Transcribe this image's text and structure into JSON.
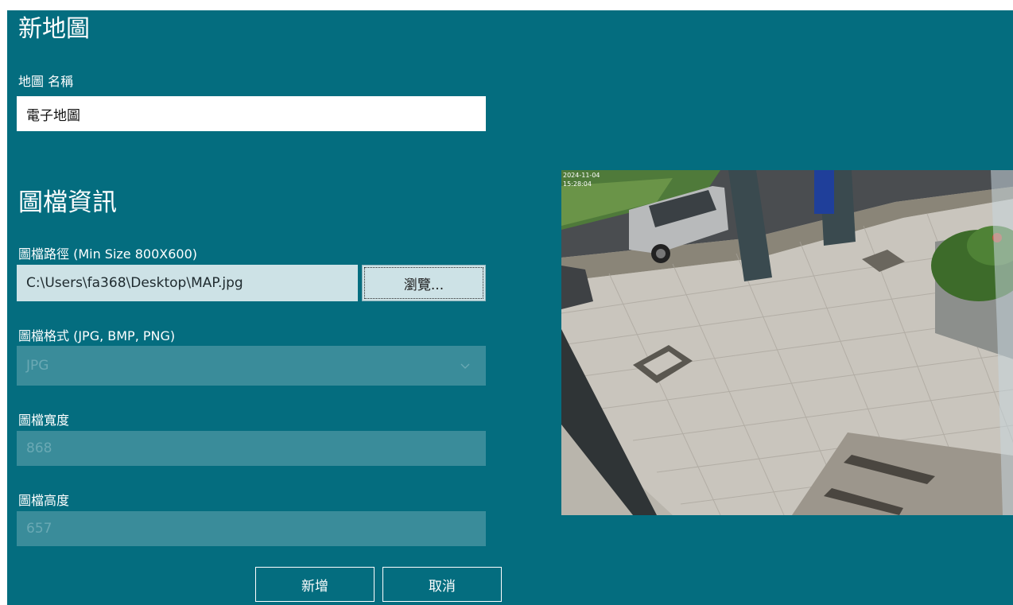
{
  "page": {
    "title": "新地圖",
    "section_title": "圖檔資訊"
  },
  "map_name": {
    "label": "地圖 名稱",
    "value": "電子地圖"
  },
  "image_path": {
    "label": "圖檔路徑 (Min Size 800X600)",
    "value": "C:\\Users\\fa368\\Desktop\\MAP.jpg",
    "browse_label": "瀏覽..."
  },
  "image_format": {
    "label": "圖檔格式 (JPG, BMP, PNG)",
    "selected": "JPG"
  },
  "image_width": {
    "label": "圖檔寬度",
    "value": "868"
  },
  "image_height": {
    "label": "圖檔高度",
    "value": "657"
  },
  "actions": {
    "add_label": "新增",
    "cancel_label": "取消"
  },
  "preview": {
    "overlay_date": "2024-11-04",
    "overlay_time": "15:28:04",
    "content": "camera-snapshot-street-sidewalk"
  },
  "colors": {
    "background": "#046d7f",
    "input_disabled": "#3a8c9a",
    "input_path": "#cde2e6"
  },
  "icons": {
    "select_chevron": "chevron-down-icon"
  }
}
